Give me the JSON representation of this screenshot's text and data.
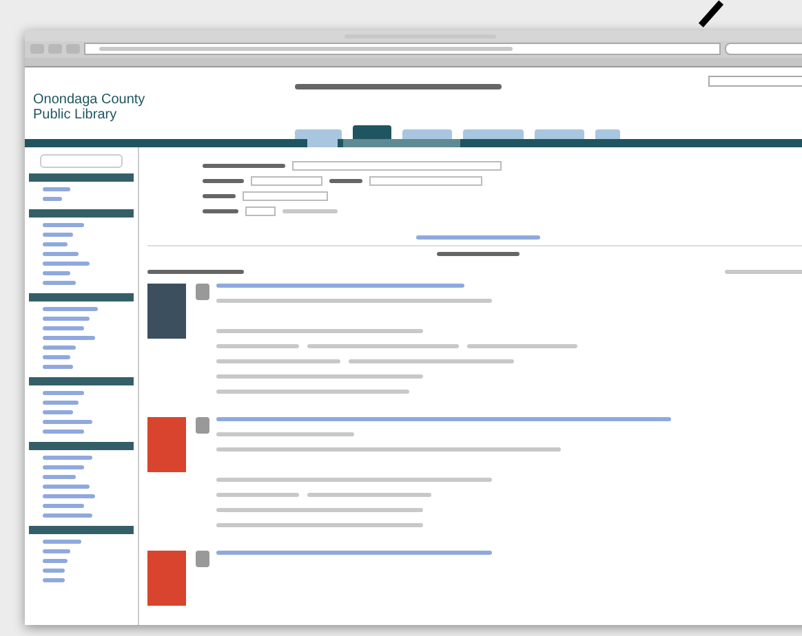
{
  "library": {
    "name_lines": [
      "Onondaga County",
      "Public Library"
    ]
  },
  "tabs": [
    {
      "selected": false
    },
    {
      "selected": true
    },
    {
      "selected": false
    },
    {
      "selected": false
    },
    {
      "selected": false
    },
    {
      "selected": false
    }
  ]
}
